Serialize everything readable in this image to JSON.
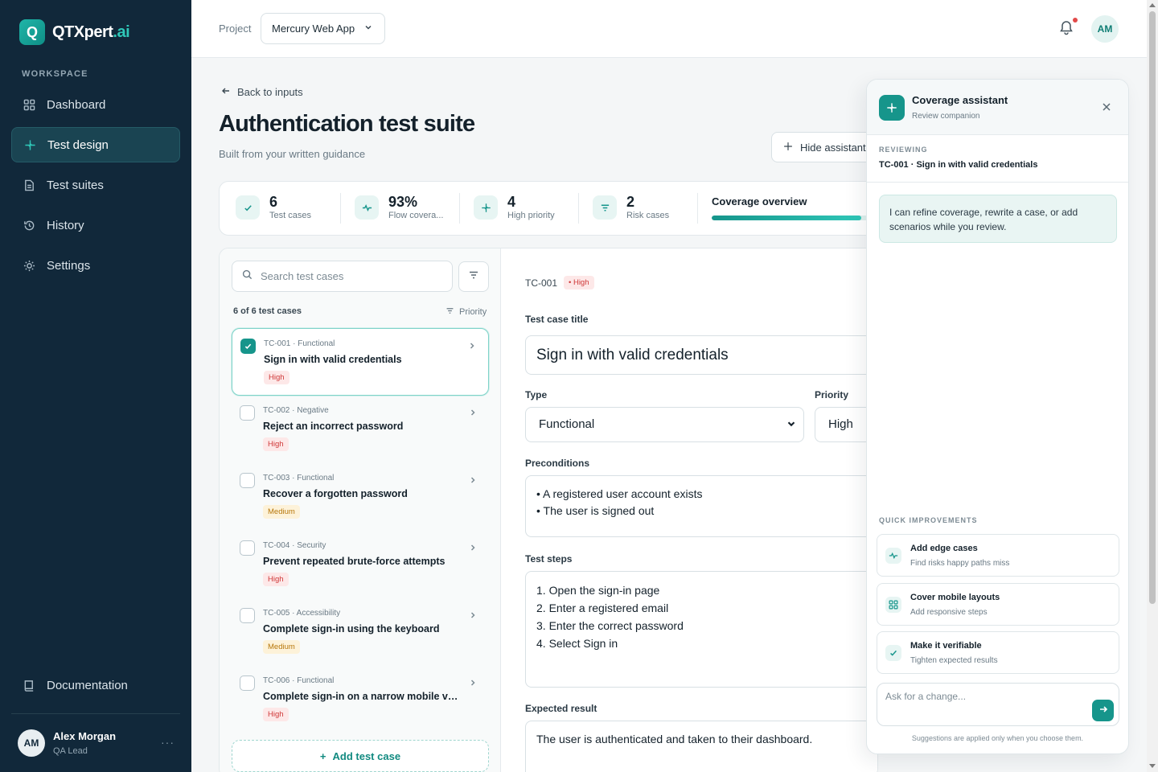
{
  "brand": {
    "initial": "Q",
    "name_main": "QTXpert",
    "name_suffix": ".ai"
  },
  "sidebar": {
    "section_label": "WORKSPACE",
    "items": [
      {
        "label": "Dashboard",
        "icon": "grid-icon"
      },
      {
        "label": "Test design",
        "icon": "sparkle-icon",
        "active": true
      },
      {
        "label": "Test suites",
        "icon": "document-icon"
      },
      {
        "label": "History",
        "icon": "history-icon"
      },
      {
        "label": "Settings",
        "icon": "sun-gear-icon"
      }
    ],
    "docs_label": "Documentation",
    "user": {
      "initials": "AM",
      "name": "Alex Morgan",
      "role": "QA Lead"
    }
  },
  "topbar": {
    "project_label": "Project",
    "project_value": "Mercury Web App",
    "avatar_initials": "AM"
  },
  "page": {
    "back_label": "Back to inputs",
    "title": "Authentication test suite",
    "subtitle": "Built from your written guidance",
    "hide_assistant_label": "Hide assistant"
  },
  "stats": [
    {
      "value": "6",
      "label": "Test cases",
      "icon": "check-icon"
    },
    {
      "value": "93%",
      "label": "Flow covera...",
      "icon": "pulse-icon"
    },
    {
      "value": "4",
      "label": "High priority",
      "icon": "sparkle-icon"
    },
    {
      "value": "2",
      "label": "Risk cases",
      "icon": "filter-icon"
    }
  ],
  "coverage": {
    "title": "Coverage overview",
    "fill_fraction": 0.93
  },
  "list": {
    "search_placeholder": "Search test cases",
    "count_label": "6 of 6 test cases",
    "sort_label": "Priority",
    "cases": [
      {
        "meta": "TC-001 · Functional",
        "title": "Sign in with valid credentials",
        "priority": "High",
        "level": "high",
        "selected": true
      },
      {
        "meta": "TC-002 · Negative",
        "title": "Reject an incorrect password",
        "priority": "High",
        "level": "high"
      },
      {
        "meta": "TC-003 · Functional",
        "title": "Recover a forgotten password",
        "priority": "Medium",
        "level": "medium"
      },
      {
        "meta": "TC-004 · Security",
        "title": "Prevent repeated brute-force attempts",
        "priority": "High",
        "level": "high"
      },
      {
        "meta": "TC-005 · Accessibility",
        "title": "Complete sign-in using the keyboard",
        "priority": "Medium",
        "level": "medium"
      },
      {
        "meta": "TC-006 · Functional",
        "title": "Complete sign-in on a narrow mobile viewp...",
        "priority": "High",
        "level": "high"
      }
    ],
    "add_label": "Add test case"
  },
  "detail": {
    "id": "TC-001",
    "priority_badge": "• High",
    "title_label": "Test case title",
    "title_value": "Sign in with valid credentials",
    "type_label": "Type",
    "type_value": "Functional",
    "priority_label": "Priority",
    "priority_value": "High",
    "preconditions_label": "Preconditions",
    "preconditions": [
      "• A registered user account exists",
      "• The user is signed out"
    ],
    "steps_label": "Test steps",
    "steps": [
      "1. Open the sign-in page",
      "2. Enter a registered email",
      "3. Enter the correct password",
      "4. Select Sign in"
    ],
    "expected_label": "Expected result",
    "expected_value": "The user is authenticated and taken to their dashboard."
  },
  "assistant": {
    "title": "Coverage assistant",
    "subtitle": "Review companion",
    "reviewing_label": "REVIEWING",
    "reviewing_value": "TC-001 · Sign in with valid credentials",
    "message": "I can refine coverage, rewrite a case, or add scenarios while you review.",
    "quick_label": "QUICK IMPROVEMENTS",
    "quick": [
      {
        "title": "Add edge cases",
        "sub": "Find risks happy paths miss",
        "icon": "pulse-icon"
      },
      {
        "title": "Cover mobile layouts",
        "sub": "Add responsive steps",
        "icon": "grid-icon"
      },
      {
        "title": "Make it verifiable",
        "sub": "Tighten expected results",
        "icon": "check-icon"
      }
    ],
    "ask_placeholder": "Ask for a change...",
    "footer": "Suggestions are applied only when you choose them."
  },
  "colors": {
    "sidebar": "#11283a",
    "accent": "#16958b",
    "high": "#cf3838",
    "medium": "#b7770b"
  }
}
